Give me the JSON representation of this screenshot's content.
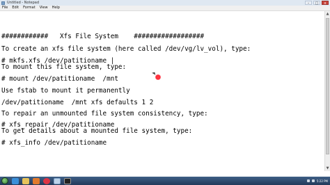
{
  "window": {
    "title": "Untitled - Notepad",
    "controls": {
      "minimize": "–",
      "maximize": "□",
      "close": "x"
    }
  },
  "menu": [
    "File",
    "Edit",
    "Format",
    "View",
    "Help"
  ],
  "editor": {
    "lines": [
      "############   Xfs File System    ##################",
      "To create an xfs file system (here called /dev/vg/lv_vol), type:",
      "# mkfs.xfs /dev/patitioname |",
      "To mount this file system, type:",
      "# mount /dev/patitioname  /mnt",
      "Use fstab to mount it permanently",
      "/dev/patitioname  /mnt xfs defaults 1 2",
      "To repair an unmounted file system consistency, type:",
      "# xfs_repair /dev/patitioname",
      "To get details about a mounted file system, type:",
      "# xfs_info /dev/patitioname"
    ]
  },
  "scrollbar": {
    "up_arrow": "▲",
    "down_arrow": "▼"
  },
  "taskbar": {
    "clock": "5:22 PM"
  },
  "colors": {
    "titlebar": "#dfe8f2",
    "taskbar": "#2f4c72",
    "cursor_highlight": "#ff2233"
  }
}
